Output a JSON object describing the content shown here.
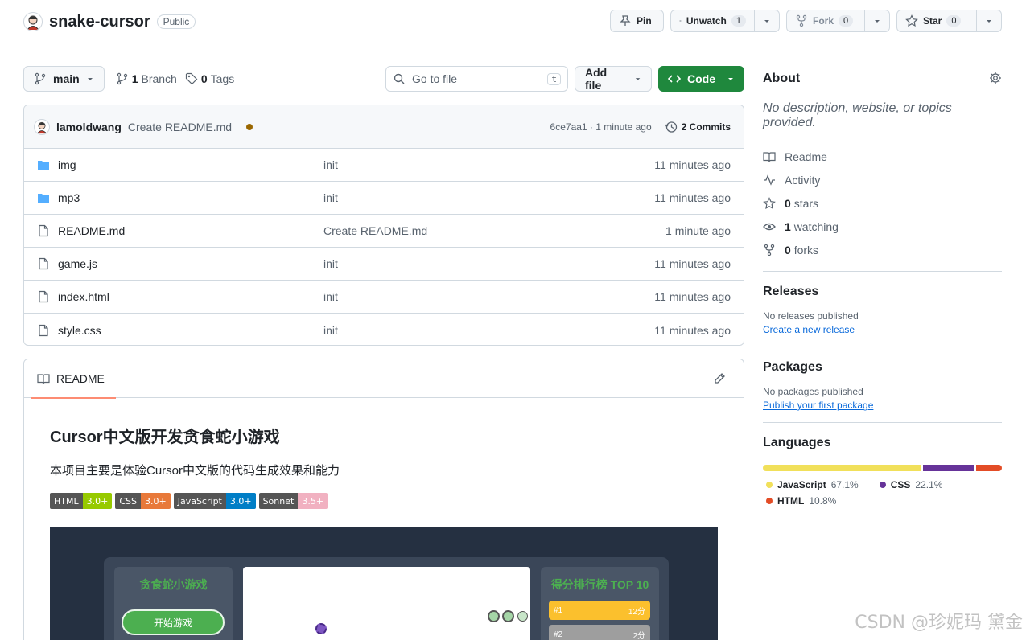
{
  "repo": {
    "name": "snake-cursor",
    "visibility": "Public"
  },
  "header_actions": {
    "pin_label": "Pin",
    "unwatch_label": "Unwatch",
    "watch_count": "1",
    "fork_label": "Fork",
    "fork_count": "0",
    "star_label": "Star",
    "star_count": "0"
  },
  "toolbar": {
    "branch": "main",
    "branches_count": "1",
    "branches_label": "Branch",
    "tags_count": "0",
    "tags_label": "Tags",
    "goto_placeholder": "Go to file",
    "goto_shortcut": "t",
    "add_file_label": "Add file",
    "code_label": "Code"
  },
  "latest_commit": {
    "author": "lamoldwang",
    "message": "Create README.md",
    "meta": "6ce7aa1 · 1 minute ago",
    "commits_label": "2 Commits"
  },
  "files": [
    {
      "name": "img",
      "type": "folder",
      "message": "init",
      "time": "11 minutes ago"
    },
    {
      "name": "mp3",
      "type": "folder",
      "message": "init",
      "time": "11 minutes ago"
    },
    {
      "name": "README.md",
      "type": "file",
      "message": "Create README.md",
      "time": "1 minute ago"
    },
    {
      "name": "game.js",
      "type": "file",
      "message": "init",
      "time": "11 minutes ago"
    },
    {
      "name": "index.html",
      "type": "file",
      "message": "init",
      "time": "11 minutes ago"
    },
    {
      "name": "style.css",
      "type": "file",
      "message": "init",
      "time": "11 minutes ago"
    }
  ],
  "readme": {
    "tab_label": "README",
    "title": "Cursor中文版开发贪食蛇小游戏",
    "description": "本项目主要是体验Cursor中文版的代码生成效果和能力",
    "badges": [
      {
        "label": "HTML",
        "value": "3.0+",
        "color": "#97ca00"
      },
      {
        "label": "CSS",
        "value": "3.0+",
        "color": "#e8793a"
      },
      {
        "label": "JavaScript",
        "value": "3.0+",
        "color": "#007ec6"
      },
      {
        "label": "Sonnet",
        "value": "3.5+",
        "color": "#f1b1c1"
      }
    ],
    "preview": {
      "game_title": "贪食蛇小游戏",
      "start_button": "开始游戏",
      "leaderboard_title": "得分排行榜 TOP 10",
      "ranks": [
        {
          "rank": "#1",
          "score": "12分"
        },
        {
          "rank": "#2",
          "score": "2分"
        }
      ]
    }
  },
  "about": {
    "title": "About",
    "description": "No description, website, or topics provided.",
    "items": [
      {
        "icon": "book-icon",
        "bold": "",
        "text": "Readme"
      },
      {
        "icon": "pulse-icon",
        "bold": "",
        "text": "Activity"
      },
      {
        "icon": "star-icon",
        "bold": "0",
        "text": "stars"
      },
      {
        "icon": "eye-icon",
        "bold": "1",
        "text": "watching"
      },
      {
        "icon": "fork-icon",
        "bold": "0",
        "text": "forks"
      }
    ]
  },
  "releases": {
    "title": "Releases",
    "empty": "No releases published",
    "link": "Create a new release"
  },
  "packages": {
    "title": "Packages",
    "empty": "No packages published",
    "link": "Publish your first package"
  },
  "languages": {
    "title": "Languages",
    "items": [
      {
        "name": "JavaScript",
        "percent": "67.1%",
        "value": 67.1,
        "color": "#f1e05a"
      },
      {
        "name": "CSS",
        "percent": "22.1%",
        "value": 22.1,
        "color": "#663399"
      },
      {
        "name": "HTML",
        "percent": "10.8%",
        "value": 10.8,
        "color": "#e34c26"
      }
    ]
  },
  "watermark": "CSDN @珍妮玛 黛金"
}
